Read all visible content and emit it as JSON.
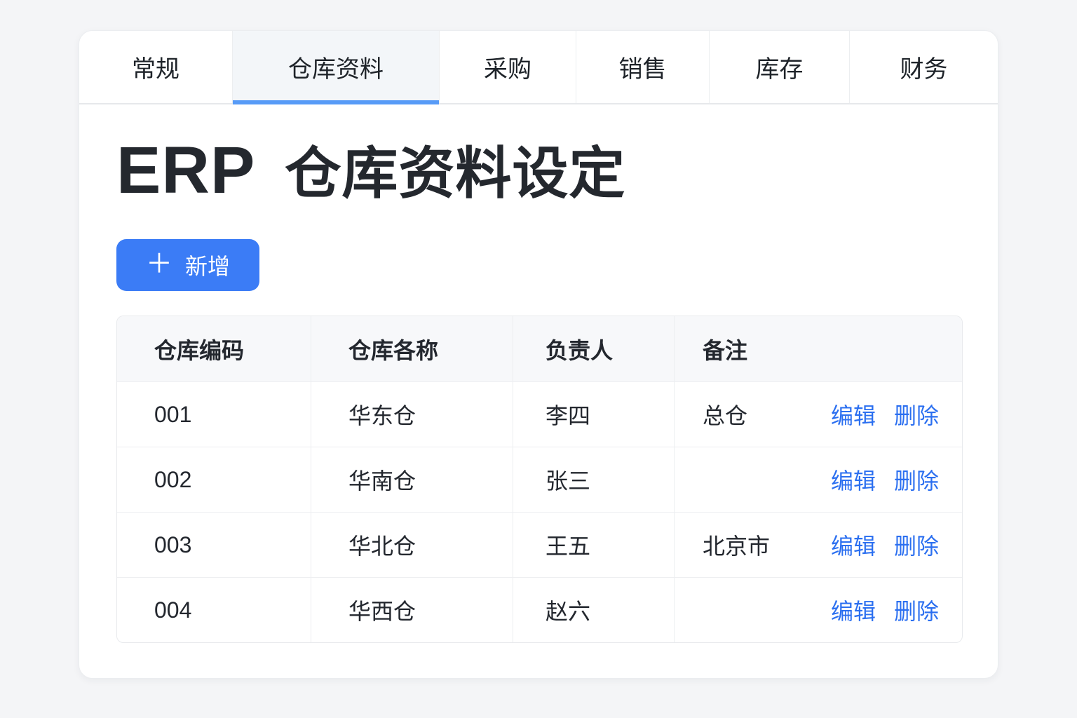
{
  "tabs": [
    {
      "label": "常规",
      "active": false
    },
    {
      "label": "仓库资料",
      "active": true
    },
    {
      "label": "采购",
      "active": false
    },
    {
      "label": "销售",
      "active": false
    },
    {
      "label": "库存",
      "active": false
    },
    {
      "label": "财务",
      "active": false
    }
  ],
  "header": {
    "title_en": "ERP",
    "title_zh": "仓库资料设定"
  },
  "toolbar": {
    "add_button": {
      "icon": "＋",
      "label": "新增"
    }
  },
  "table": {
    "columns": {
      "code": "仓库编码",
      "name": "仓库各称",
      "manager": "负责人",
      "remark": "备注"
    },
    "row_actions": {
      "edit": "编辑",
      "delete": "删除"
    },
    "rows": [
      {
        "code": "001",
        "name": "华东仓",
        "manager": "李四",
        "remark": "总仓"
      },
      {
        "code": "002",
        "name": "华南仓",
        "manager": "张三",
        "remark": ""
      },
      {
        "code": "003",
        "name": "华北仓",
        "manager": "王五",
        "remark": "北京市"
      },
      {
        "code": "004",
        "name": "华西仓",
        "manager": "赵六",
        "remark": ""
      }
    ]
  },
  "colors": {
    "accent_blue": "#3b7cf6",
    "link_blue": "#2b6ff0",
    "tab_underline": "#579bf7",
    "page_background": "#f4f5f7"
  }
}
